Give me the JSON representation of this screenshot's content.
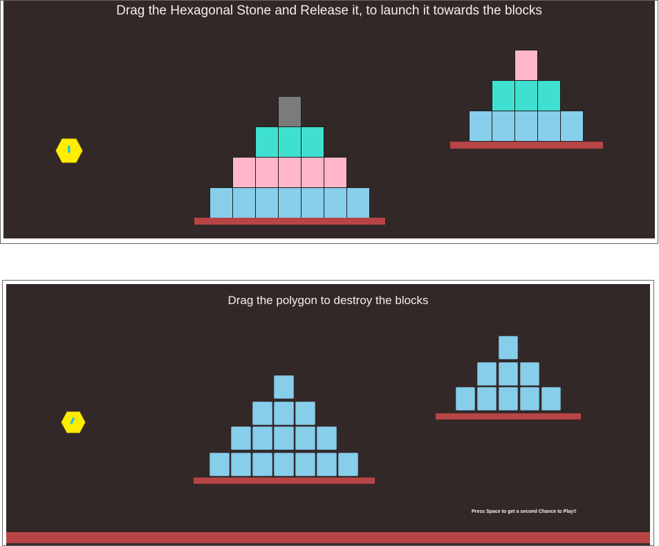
{
  "panel_top": {
    "title": "Drag the Hexagonal Stone and Release it, to launch it towards the blocks",
    "stone_icon": "yellow-hexagon-stone"
  },
  "panel_bottom": {
    "title": "Drag the polygon to destroy the blocks",
    "hint": "Press Space to get a second Chance to Play!!",
    "stone_icon": "yellow-hexagon-stone"
  },
  "colors": {
    "background": "#332828",
    "ground": "#b84545",
    "block_blue": "#87ceeb",
    "block_pink": "#ffb6c9",
    "block_teal": "#40e0d0",
    "block_gray": "#7b7b7b",
    "stone": "#ffee00",
    "stone_mark": "#2ec4d0"
  }
}
